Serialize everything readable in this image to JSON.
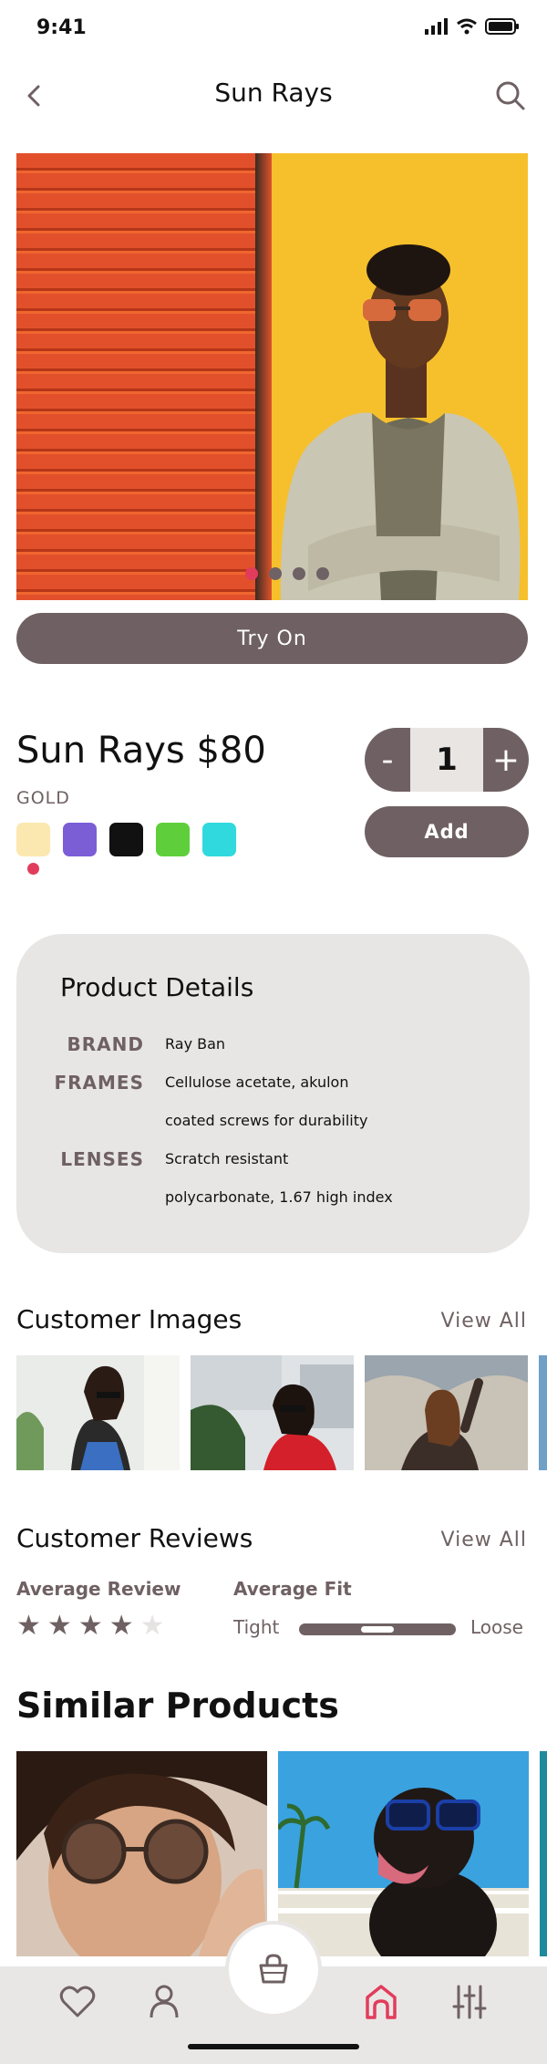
{
  "status_bar": {
    "time": "9:41"
  },
  "header": {
    "title": "Sun Rays"
  },
  "hero": {
    "dots_count": 4,
    "active_dot": 0
  },
  "try_on": {
    "label": "Try On"
  },
  "product": {
    "title": "Sun Rays $80",
    "color_name": "GOLD",
    "swatches": [
      "#fbe8b0",
      "#7b5dd6",
      "#111111",
      "#5ecf3a",
      "#30d9dd"
    ],
    "selected_swatch": 0
  },
  "quantity": {
    "minus": "-",
    "value": "1",
    "plus": "+"
  },
  "add": {
    "label": "Add"
  },
  "details": {
    "title": "Product Details",
    "brand_key": "BRAND",
    "brand_val": "Ray Ban",
    "frames_key": "FRAMES",
    "frames_val_1": "Cellulose acetate, akulon",
    "frames_val_2": "coated screws for durability",
    "lenses_key": "LENSES",
    "lenses_val_1": "Scratch resistant",
    "lenses_val_2": "polycarbonate, 1.67 high index"
  },
  "customer_images": {
    "title": "Customer Images",
    "view_all": "View All"
  },
  "customer_reviews": {
    "title": "Customer Reviews",
    "view_all": "View All",
    "average_review_label": "Average Review",
    "rating": 4,
    "rating_max": 5,
    "average_fit_label": "Average Fit",
    "fit_left": "Tight",
    "fit_right": "Loose",
    "fit_value": 0.5
  },
  "similar": {
    "title": "Similar Products"
  },
  "colors": {
    "accent": "#e23c5c",
    "primary": "#6f6163",
    "card": "#e8e6e5"
  }
}
